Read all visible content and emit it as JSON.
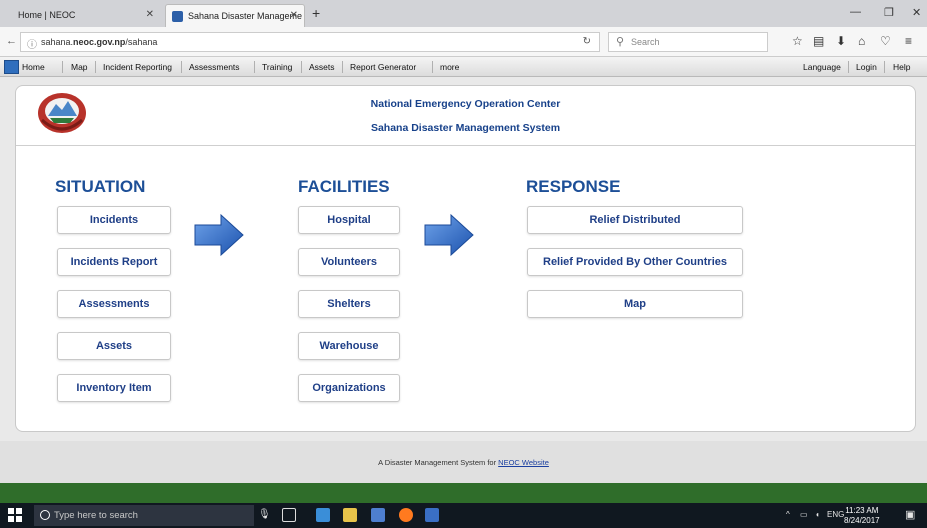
{
  "browser": {
    "tabs": [
      {
        "label": "Home | NEOC",
        "active": false
      },
      {
        "label": "Sahana Disaster Manageme",
        "active": true
      }
    ],
    "url_prefix": "sahana.",
    "url_domain": "neoc.gov.np",
    "url_path": "/sahana",
    "search_placeholder": "Search"
  },
  "menubar": {
    "items": [
      "Home",
      "Map",
      "Incident Reporting",
      "Assessments",
      "Training",
      "Assets",
      "Report Generator",
      "more"
    ],
    "right_items": [
      "Language",
      "Login",
      "Help"
    ]
  },
  "header": {
    "line1": "National Emergency Operation Center",
    "line2": "Sahana Disaster Management System"
  },
  "columns": {
    "situation": {
      "title": "SITUATION",
      "buttons": [
        "Incidents",
        "Incidents Report",
        "Assessments",
        "Assets",
        "Inventory Item"
      ]
    },
    "facilities": {
      "title": "FACILITIES",
      "buttons": [
        "Hospital",
        "Volunteers",
        "Shelters",
        "Warehouse",
        "Organizations"
      ]
    },
    "response": {
      "title": "RESPONSE",
      "buttons": [
        "Relief Distributed",
        "Relief Provided By Other Countries",
        "Map"
      ]
    }
  },
  "footer": {
    "text": "A Disaster Management System for",
    "link": "NEOC Website"
  },
  "taskbar": {
    "search_placeholder": "Type here to search",
    "lang": "ENG",
    "time": "11:23 AM",
    "date": "8/24/2017"
  },
  "colors": {
    "title_blue": "#1d4f97",
    "button_text": "#1f3f87",
    "arrow_blue": "#2a66c2",
    "footer_green": "#2f6d2a"
  }
}
